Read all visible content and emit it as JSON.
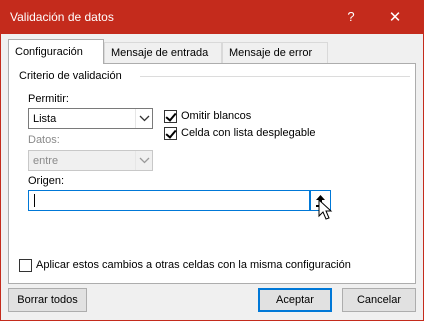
{
  "window": {
    "title": "Validación de datos",
    "help_label": "?",
    "close_label": "✕",
    "accent_color": "#c42b1c"
  },
  "tabs": [
    {
      "label": "Configuración",
      "active": true
    },
    {
      "label": "Mensaje de entrada",
      "active": false
    },
    {
      "label": "Mensaje de error",
      "active": false
    }
  ],
  "criteria": {
    "section_title": "Criterio de validación",
    "allow_label": "Permitir:",
    "allow_value": "Lista",
    "data_label": "Datos:",
    "data_value": "entre",
    "data_disabled": true,
    "ignore_blank_label": "Omitir blancos",
    "ignore_blank_checked": true,
    "in_cell_dropdown_label": "Celda con lista desplegable",
    "in_cell_dropdown_checked": true,
    "source_label": "Origen:",
    "source_value": "",
    "apply_all_label": "Aplicar estos cambios a otras celdas con la misma configuración",
    "apply_all_checked": false
  },
  "buttons": {
    "clear_all": "Borrar todos",
    "ok": "Aceptar",
    "cancel": "Cancelar"
  },
  "icons": {
    "dropdown": "chevron-down-icon",
    "collapse": "collapse-upload-icon",
    "cursor": "mouse-pointer-icon"
  }
}
